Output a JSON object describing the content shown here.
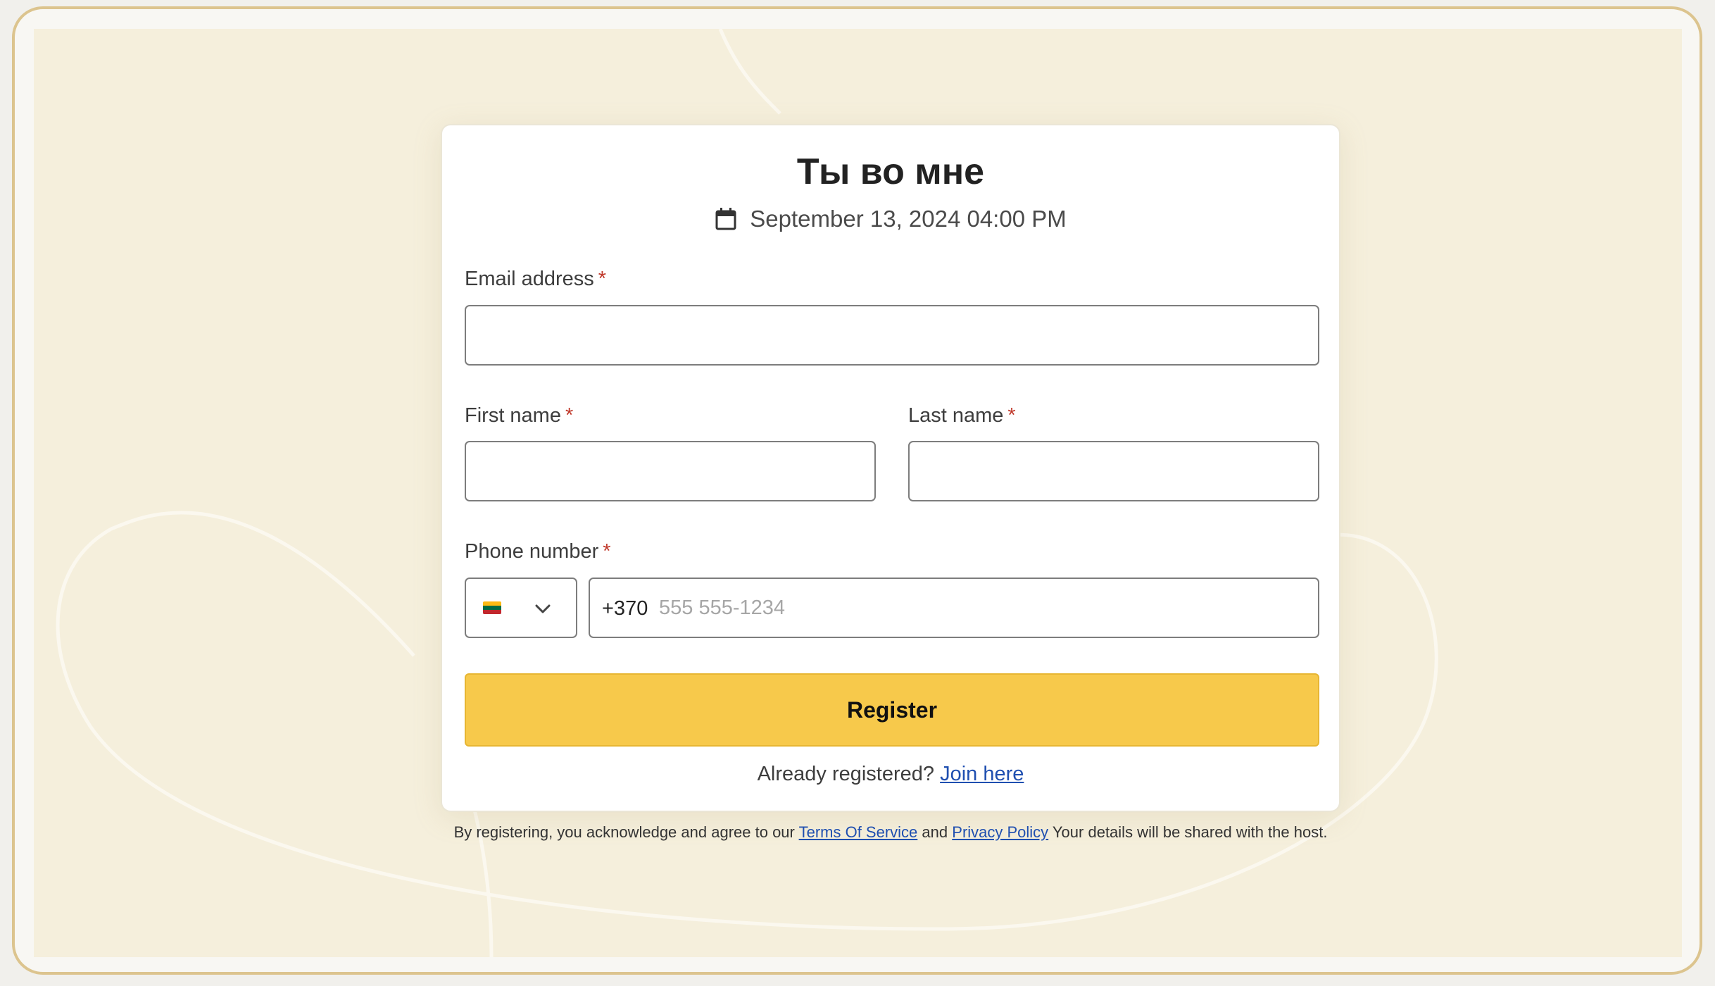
{
  "event": {
    "title": "Ты во мне",
    "datetime": "September 13, 2024 04:00 PM",
    "calendar_icon": "calendar-icon"
  },
  "form": {
    "email_label": "Email address",
    "first_name_label": "First name",
    "last_name_label": "Last name",
    "phone_label": "Phone number",
    "required_mark": "*",
    "email_value": "",
    "first_name_value": "",
    "last_name_value": "",
    "phone": {
      "country_flag": "lithuania-flag-icon",
      "dial_code": "+370",
      "placeholder": "555 555-1234",
      "value": ""
    },
    "register_label": "Register"
  },
  "login_prompt": {
    "text": "Already registered?",
    "link": "Join here"
  },
  "legal": {
    "prefix": "By registering, you acknowledge and agree to our",
    "terms_link": "Terms Of Service",
    "and": "and",
    "privacy_link": "Privacy Policy",
    "suffix": "Your details will be shared with the host."
  },
  "colors": {
    "background": "#f5efdc",
    "frame_border": "#dcc48e",
    "button": "#f7c94b",
    "link": "#1f4fb0",
    "required": "#c0392b"
  }
}
